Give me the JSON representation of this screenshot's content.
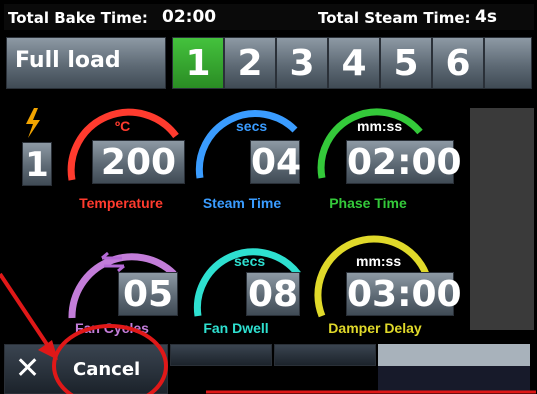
{
  "header": {
    "total_bake_label": "Total Bake Time:",
    "total_bake_value": "02:00",
    "total_steam_label": "Total Steam Time:",
    "total_steam_value": "4s"
  },
  "program": {
    "name": "Full load"
  },
  "tabs": [
    {
      "label": "1",
      "active": true
    },
    {
      "label": "2",
      "active": false
    },
    {
      "label": "3",
      "active": false
    },
    {
      "label": "4",
      "active": false
    },
    {
      "label": "5",
      "active": false
    },
    {
      "label": "6",
      "active": false
    }
  ],
  "phase": {
    "number": "1",
    "icon": "lightning-icon"
  },
  "dials": {
    "temperature": {
      "unit": "ºC",
      "value": "200",
      "label": "Temperature",
      "color": "#ff3b2e"
    },
    "steam_time": {
      "unit": "secs",
      "value": "04",
      "label": "Steam Time",
      "color": "#3a9cff"
    },
    "phase_time": {
      "unit": "mm:ss",
      "value": "02:00",
      "label": "Phase Time",
      "color": "#34c93a"
    },
    "fan_cycles": {
      "unit": "",
      "value": "05",
      "label": "Fan Cycles",
      "color": "#c37dd9"
    },
    "fan_dwell": {
      "unit": "secs",
      "value": "08",
      "label": "Fan Dwell",
      "color": "#2ee0d0"
    },
    "damper_delay": {
      "unit": "mm:ss",
      "value": "03:00",
      "label": "Damper Delay",
      "color": "#e0d92a"
    }
  },
  "footer": {
    "cancel_label": "Cancel",
    "cancel_icon": "close-icon"
  },
  "colors": {
    "accent_green": "#3bb534",
    "annotation_red": "#e01818"
  }
}
